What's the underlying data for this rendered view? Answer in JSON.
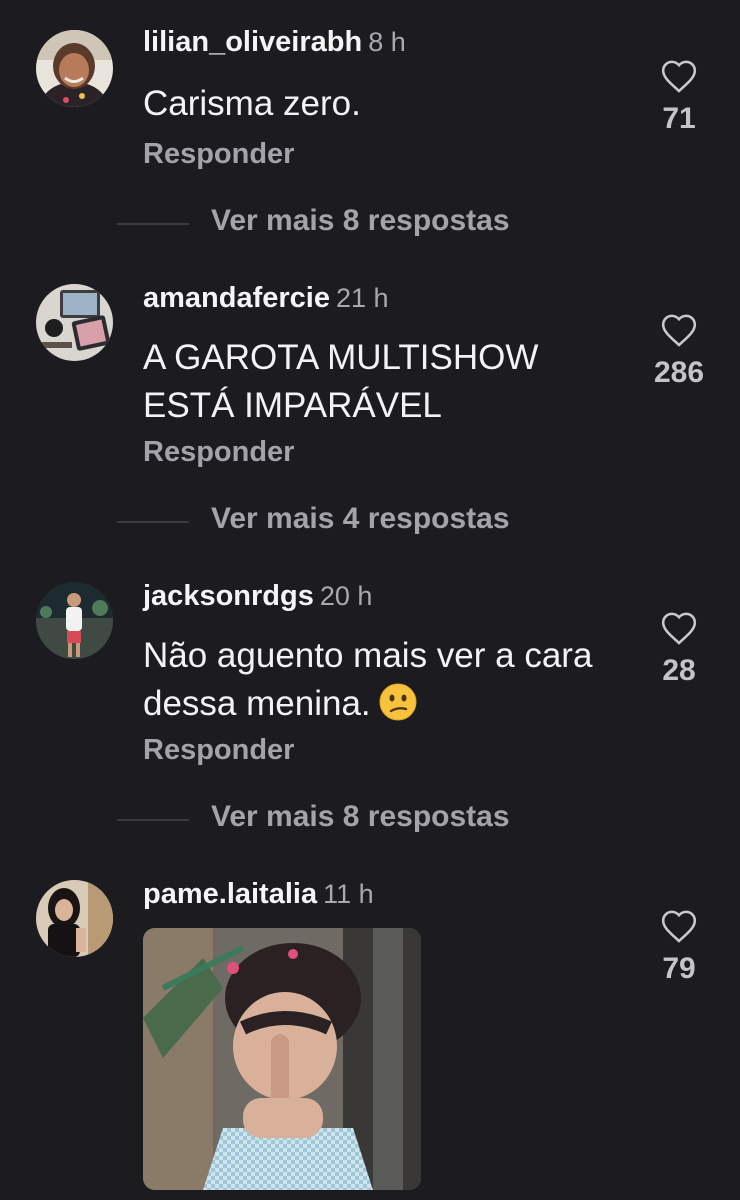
{
  "comments": [
    {
      "username": "lilian_oliveirabh",
      "time": "8 h",
      "text": "Carisma zero.",
      "reply_label": "Responder",
      "likes": "71",
      "more_replies": "Ver mais 8 respostas"
    },
    {
      "username": "amandafercie",
      "time": "21 h",
      "text": "A GAROTA MULTISHOW ESTÁ IMPARÁVEL",
      "reply_label": "Responder",
      "likes": "286",
      "more_replies": "Ver mais 4 respostas"
    },
    {
      "username": "jacksonrdgs",
      "time": "20 h",
      "text": "Não aguento mais ver a cara dessa menina.",
      "emoji": "confused-face-emoji",
      "reply_label": "Responder",
      "likes": "28",
      "more_replies": "Ver mais 8 respostas"
    },
    {
      "username": "pame.laitalia",
      "time": "11 h",
      "media": "gif-image",
      "likes": "79"
    }
  ],
  "colors": {
    "background": "#1c1c20",
    "secondary_text": "#a3a3a9",
    "primary_text": "#f3f3f3"
  }
}
